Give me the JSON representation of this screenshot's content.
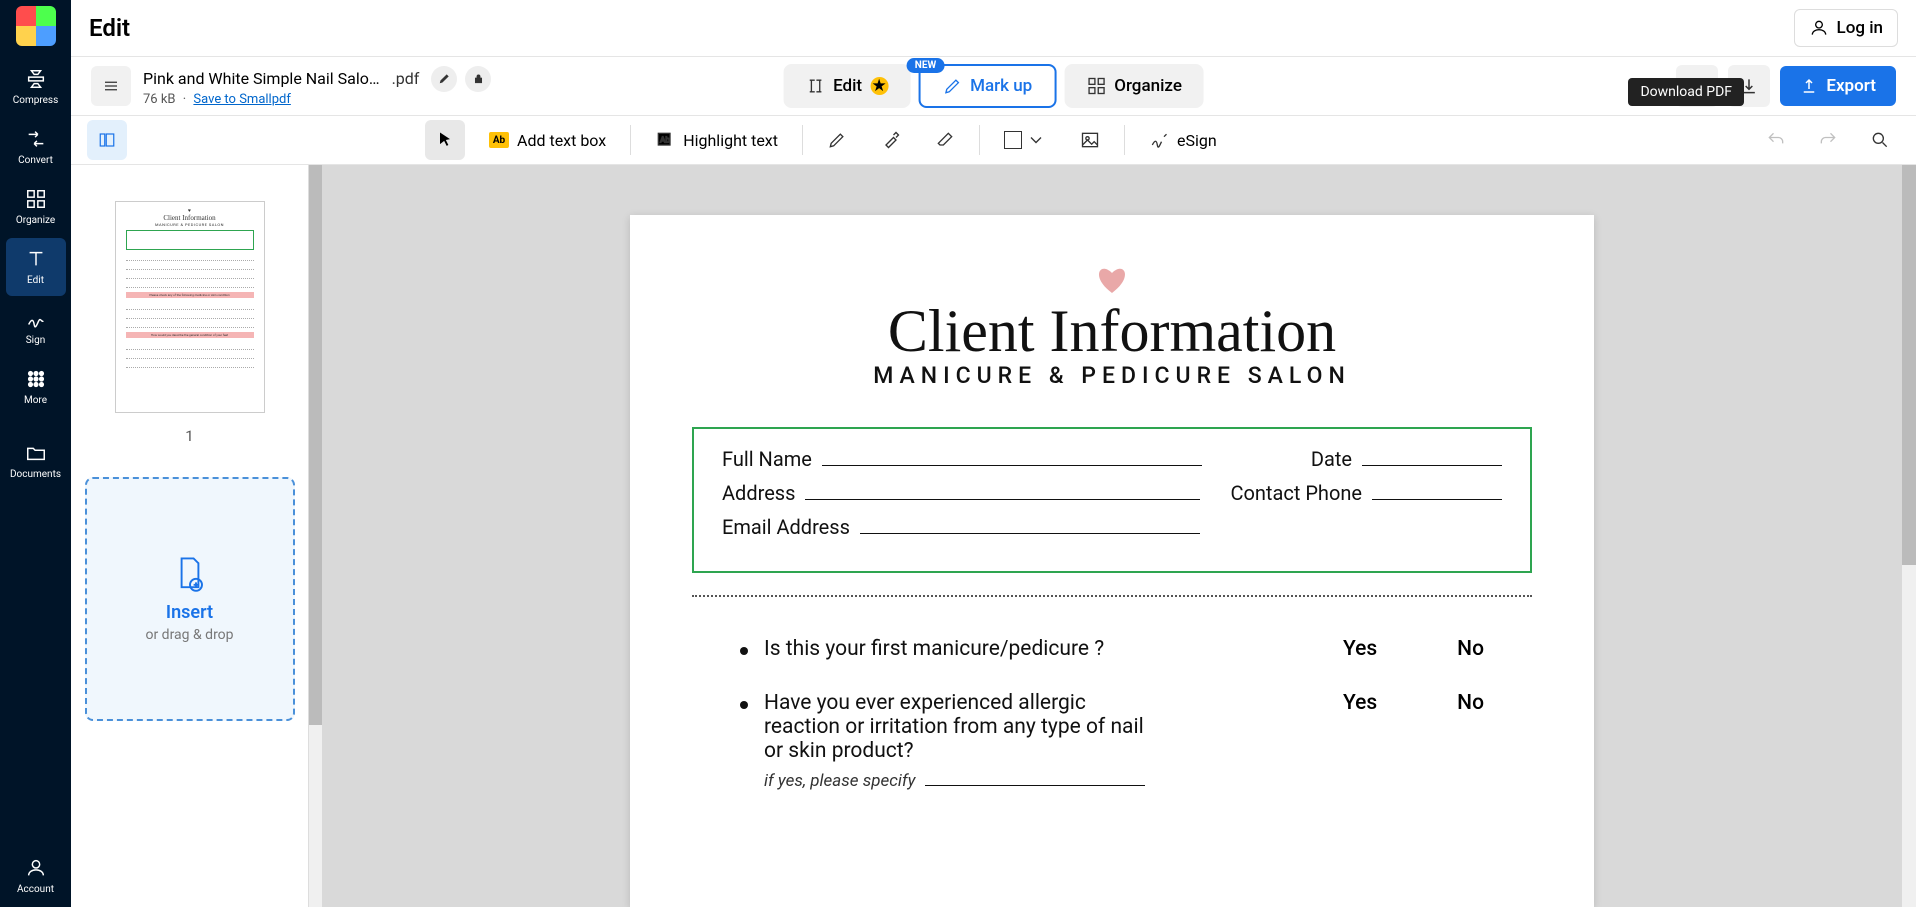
{
  "header": {
    "title": "Edit",
    "login": "Log in"
  },
  "nav": {
    "compress": "Compress",
    "convert": "Convert",
    "organize": "Organize",
    "edit": "Edit",
    "sign": "Sign",
    "more": "More",
    "documents": "Documents",
    "account": "Account"
  },
  "file": {
    "name": "Pink and White Simple Nail Salo…",
    "ext": ".pdf",
    "size": "76 kB",
    "sep": "·",
    "save": "Save to Smallpdf"
  },
  "tabs": {
    "edit": "Edit",
    "markup": "Mark up",
    "organize": "Organize",
    "new_badge": "NEW"
  },
  "actions": {
    "export": "Export"
  },
  "toolbar": {
    "add_text": "Add text box",
    "highlight": "Highlight text",
    "esign": "eSign"
  },
  "tooltip": {
    "download": "Download PDF"
  },
  "thumb": {
    "page1": "1"
  },
  "insert": {
    "label": "Insert",
    "sub": "or drag & drop"
  },
  "doc": {
    "title": "Client Information",
    "subtitle": "MANICURE & PEDICURE SALON",
    "full_name": "Full Name",
    "date": "Date",
    "address": "Address",
    "contact_phone": "Contact Phone",
    "email": "Email Address",
    "q1": "Is this your first manicure/pedicure ?",
    "q2": "Have you ever experienced allergic reaction or irritation from any type of nail or skin product?",
    "q2_sub": "if yes, please specify",
    "yes": "Yes",
    "no": "No"
  }
}
